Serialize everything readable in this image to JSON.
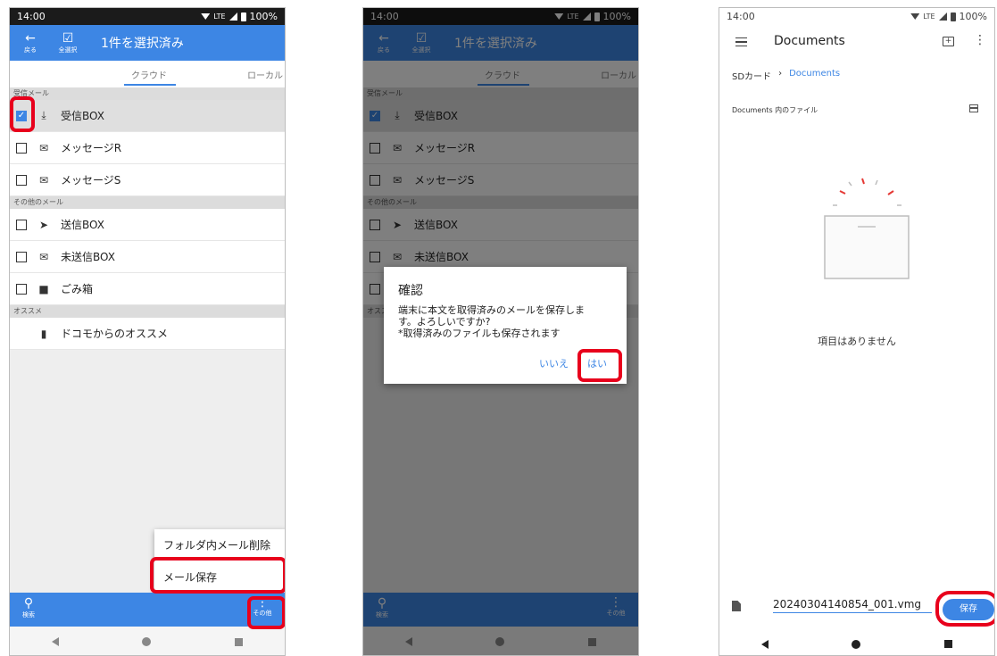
{
  "status": {
    "time": "14:00",
    "network": "LTE",
    "battery": "100%"
  },
  "appbar": {
    "back_label": "戻る",
    "select_all_label": "全選択",
    "title": "1件を選択済み"
  },
  "tabs": {
    "cloud": "クラウド",
    "local": "ローカル"
  },
  "sections": {
    "inbox": "受信メール",
    "other": "その他のメール",
    "recommend": "オススメ"
  },
  "folders": {
    "inbox": "受信BOX",
    "message_r": "メッセージR",
    "message_s": "メッセージS",
    "sent": "送信BOX",
    "unsent": "未送信BOX",
    "trash": "ごみ箱",
    "docomo": "ドコモからのオススメ"
  },
  "bottom": {
    "search_label": "検索",
    "more_label": "その他"
  },
  "popup_menu": {
    "delete_folder_mail": "フォルダ内メール削除",
    "save_mail": "メール保存"
  },
  "dialog": {
    "title": "確認",
    "message_line1": "端末に本文を取得済みのメールを保存しま",
    "message_line2": "す。よろしいですか?",
    "message_line3": "*取得済みのファイルも保存されます",
    "no_label": "いいえ",
    "yes_label": "はい"
  },
  "documents": {
    "title": "Documents",
    "breadcrumb_root": "SDカード",
    "breadcrumb_current": "Documents",
    "files_label": "Documents 内のファイル",
    "empty_text": "項目はありません",
    "filename": "20240304140854_001.vmg",
    "save_label": "保存"
  },
  "colors": {
    "accent": "#3d86e4",
    "highlight": "#e8001c"
  }
}
